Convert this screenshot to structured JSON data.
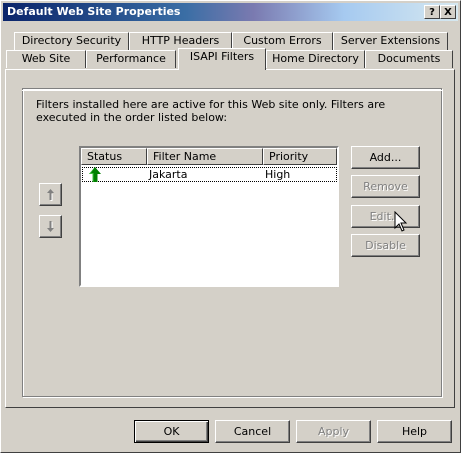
{
  "window": {
    "title": "Default Web Site Properties"
  },
  "titlebar_buttons": {
    "help": "?",
    "close": "X"
  },
  "tabs_back_row": [
    "Directory Security",
    "HTTP Headers",
    "Custom Errors",
    "Server Extensions"
  ],
  "tabs_front_row": [
    "Web Site",
    "Performance",
    "ISAPI Filters",
    "Home Directory",
    "Documents"
  ],
  "active_tab": "ISAPI Filters",
  "description": "Filters installed here are active for this Web site only. Filters are executed in the order listed below:",
  "filters": {
    "columns": [
      "Status",
      "Filter Name",
      "Priority"
    ],
    "rows": [
      {
        "status_icon": "green-up-arrow-icon",
        "name": "Jakarta",
        "priority": "High"
      }
    ]
  },
  "side_buttons": {
    "add": "Add...",
    "remove": "Remove",
    "edit": "Edit...",
    "disable": "Disable"
  },
  "bottom_buttons": {
    "ok": "OK",
    "cancel": "Cancel",
    "apply": "Apply",
    "help": "Help"
  },
  "colors": {
    "status_arrow": "#008000",
    "disabled_text": "#808080"
  }
}
